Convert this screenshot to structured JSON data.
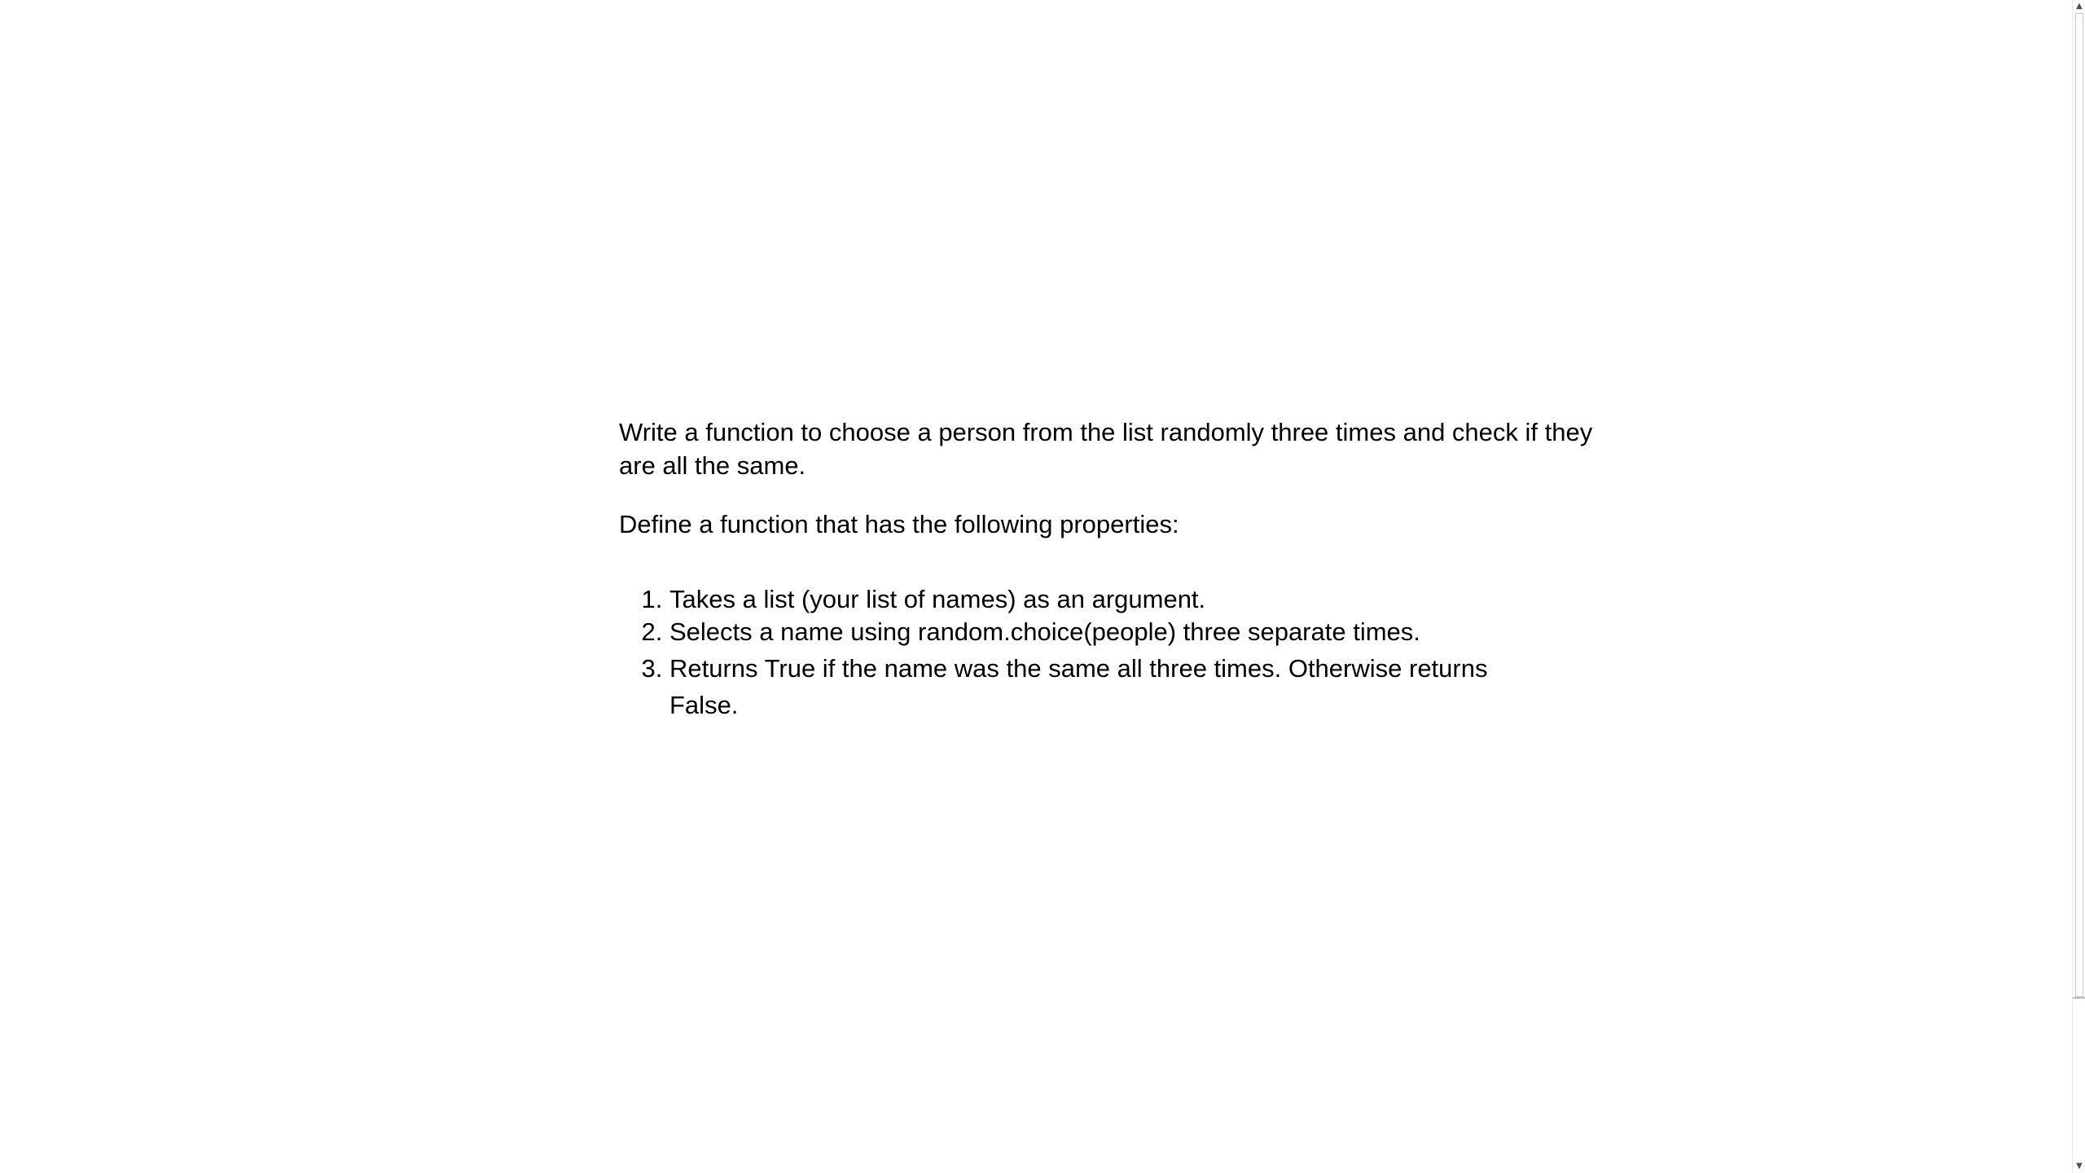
{
  "content": {
    "intro": "Write a function to choose a person from the list randomly three times and check if they are all the same.",
    "definition": "Define a function that has the following properties:",
    "items": [
      "Takes a list (your list of names) as an argument.",
      "Selects a name using random.choice(people) three separate times.",
      "Returns True if the name was the same all three times. Otherwise returns False."
    ]
  },
  "scrollbar": {
    "up_icon": "▲",
    "down_icon": "▼"
  }
}
